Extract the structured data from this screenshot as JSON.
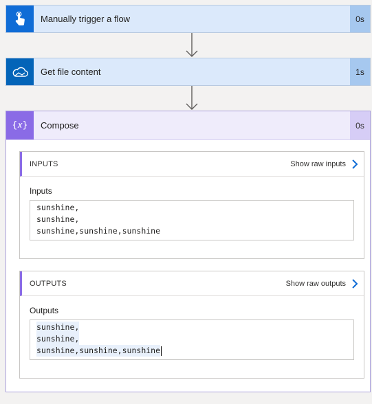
{
  "steps": {
    "trigger": {
      "title": "Manually trigger a flow",
      "duration": "0s",
      "icon": "hand-touch-icon"
    },
    "get_file": {
      "title": "Get file content",
      "duration": "1s",
      "icon": "onedrive-cloud-icon"
    },
    "compose": {
      "title": "Compose",
      "duration": "0s",
      "icon": "curly-braces-icon",
      "icon_glyph": "{𝑥}"
    }
  },
  "compose": {
    "inputs": {
      "header": "INPUTS",
      "raw_link": "Show raw inputs",
      "field_label": "Inputs",
      "lines": [
        "sunshine,",
        "sunshine,",
        "sunshine,sunshine,sunshine"
      ]
    },
    "outputs": {
      "header": "OUTPUTS",
      "raw_link": "Show raw outputs",
      "field_label": "Outputs",
      "lines": [
        "sunshine,",
        "sunshine,",
        "sunshine,sunshine,sunshine"
      ]
    }
  },
  "colors": {
    "trigger_accent": "#0f6cd6",
    "onedrive_accent": "#0364b8",
    "compose_accent": "#8a6be6",
    "link_chevron": "#0f6cd6"
  }
}
